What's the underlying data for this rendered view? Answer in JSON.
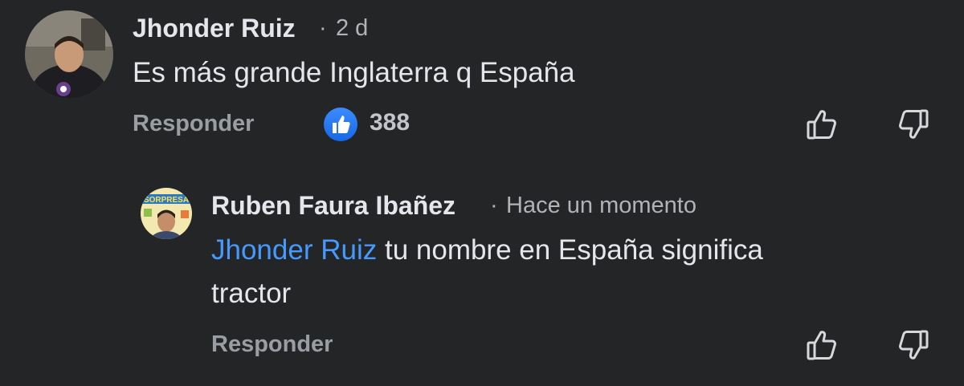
{
  "comment": {
    "author": "Jhonder Ruiz",
    "separator": "·",
    "time": "2 d",
    "text": "Es más grande Inglaterra q España",
    "reply_label": "Responder",
    "like_count": "388"
  },
  "reply": {
    "author": "Ruben Faura Ibañez",
    "separator": "·",
    "time": "Hace un momento",
    "mention": "Jhonder Ruiz",
    "text_line1": "tu nombre en España significa",
    "text_line2": "tractor",
    "reply_label": "Responder",
    "avatar_banner_text": "SORPRESA"
  },
  "icons": {
    "like": "thumbs-up-icon",
    "dislike": "thumbs-down-icon",
    "reaction": "like-reaction-icon"
  },
  "colors": {
    "background": "#242526",
    "mention": "#4599ff",
    "reaction_blue": "#1877f2"
  }
}
